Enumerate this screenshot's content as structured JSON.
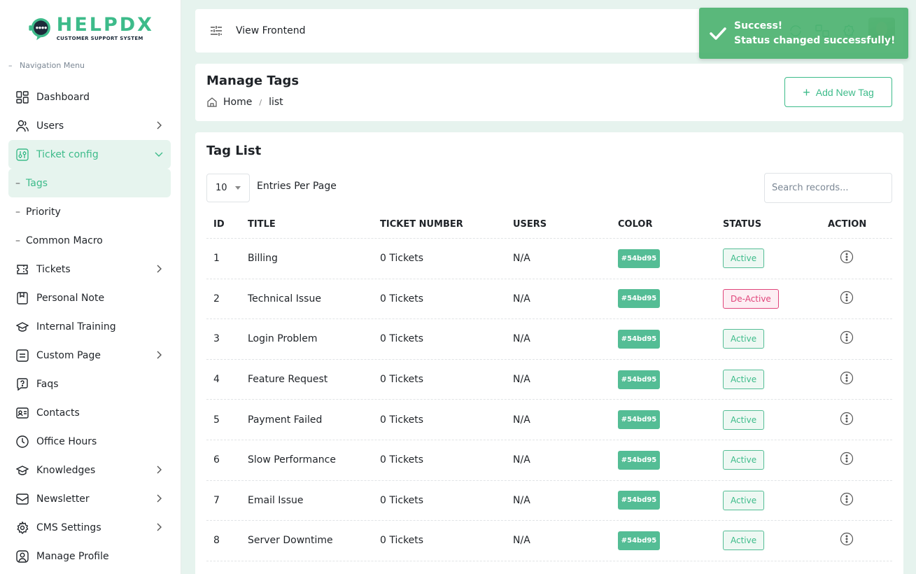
{
  "app": {
    "name": "HELPDX",
    "tagline": "CUSTOMER SUPPORT SYSTEM"
  },
  "sidebar": {
    "section_label": "Navigation Menu",
    "items": [
      {
        "label": "Dashboard",
        "icon": "dashboard-icon",
        "chevron": false
      },
      {
        "label": "Users",
        "icon": "users-icon",
        "chevron": true
      },
      {
        "label": "Ticket config",
        "icon": "ticket-config-icon",
        "chevron": true,
        "expanded": true,
        "active": true
      },
      {
        "label": "Tags",
        "sub": true,
        "active": true
      },
      {
        "label": "Priority",
        "sub": true
      },
      {
        "label": "Common Macro",
        "sub": true
      },
      {
        "label": "Tickets",
        "icon": "ticket-icon",
        "chevron": true
      },
      {
        "label": "Personal Note",
        "icon": "note-icon",
        "chevron": false
      },
      {
        "label": "Internal Training",
        "icon": "training-icon",
        "chevron": false
      },
      {
        "label": "Custom Page",
        "icon": "page-icon",
        "chevron": true
      },
      {
        "label": "Faqs",
        "icon": "faq-icon",
        "chevron": false
      },
      {
        "label": "Contacts",
        "icon": "contacts-icon",
        "chevron": false
      },
      {
        "label": "Office Hours",
        "icon": "clock-icon",
        "chevron": false
      },
      {
        "label": "Knowledges",
        "icon": "knowledge-icon",
        "chevron": true
      },
      {
        "label": "Newsletter",
        "icon": "newsletter-icon",
        "chevron": true
      },
      {
        "label": "CMS Settings",
        "icon": "settings-icon",
        "chevron": true
      },
      {
        "label": "Manage Profile",
        "icon": "profile-icon",
        "chevron": false
      }
    ]
  },
  "topbar": {
    "view_frontend": "View Frontend"
  },
  "header": {
    "title": "Manage Tags",
    "breadcrumb_home": "Home",
    "breadcrumb_current": "list",
    "add_button": "Add New Tag"
  },
  "table": {
    "title": "Tag List",
    "per_page_value": "10",
    "per_page_label": "Entries Per Page",
    "search_placeholder": "Search records...",
    "columns": [
      "ID",
      "TITLE",
      "TICKET NUMBER",
      "USERS",
      "COLOR",
      "STATUS",
      "ACTION"
    ],
    "rows": [
      {
        "id": "1",
        "title": "Billing",
        "tickets": "0 Tickets",
        "users": "N/A",
        "color": "#54bd95",
        "status": "Active"
      },
      {
        "id": "2",
        "title": "Technical Issue",
        "tickets": "0 Tickets",
        "users": "N/A",
        "color": "#54bd95",
        "status": "De-Active"
      },
      {
        "id": "3",
        "title": "Login Problem",
        "tickets": "0 Tickets",
        "users": "N/A",
        "color": "#54bd95",
        "status": "Active"
      },
      {
        "id": "4",
        "title": "Feature Request",
        "tickets": "0 Tickets",
        "users": "N/A",
        "color": "#54bd95",
        "status": "Active"
      },
      {
        "id": "5",
        "title": "Payment Failed",
        "tickets": "0 Tickets",
        "users": "N/A",
        "color": "#54bd95",
        "status": "Active"
      },
      {
        "id": "6",
        "title": "Slow Performance",
        "tickets": "0 Tickets",
        "users": "N/A",
        "color": "#54bd95",
        "status": "Active"
      },
      {
        "id": "7",
        "title": "Email Issue",
        "tickets": "0 Tickets",
        "users": "N/A",
        "color": "#54bd95",
        "status": "Active"
      },
      {
        "id": "8",
        "title": "Server Downtime",
        "tickets": "0 Tickets",
        "users": "N/A",
        "color": "#54bd95",
        "status": "Active"
      }
    ]
  },
  "toast": {
    "title": "Success!",
    "message": "Status changed successfully!"
  },
  "colors": {
    "accent": "#3dbb8a",
    "tag_color": "#54bd95",
    "deactive": "#e0447a",
    "background": "#e6f3ee",
    "toast": "#4cb270"
  }
}
